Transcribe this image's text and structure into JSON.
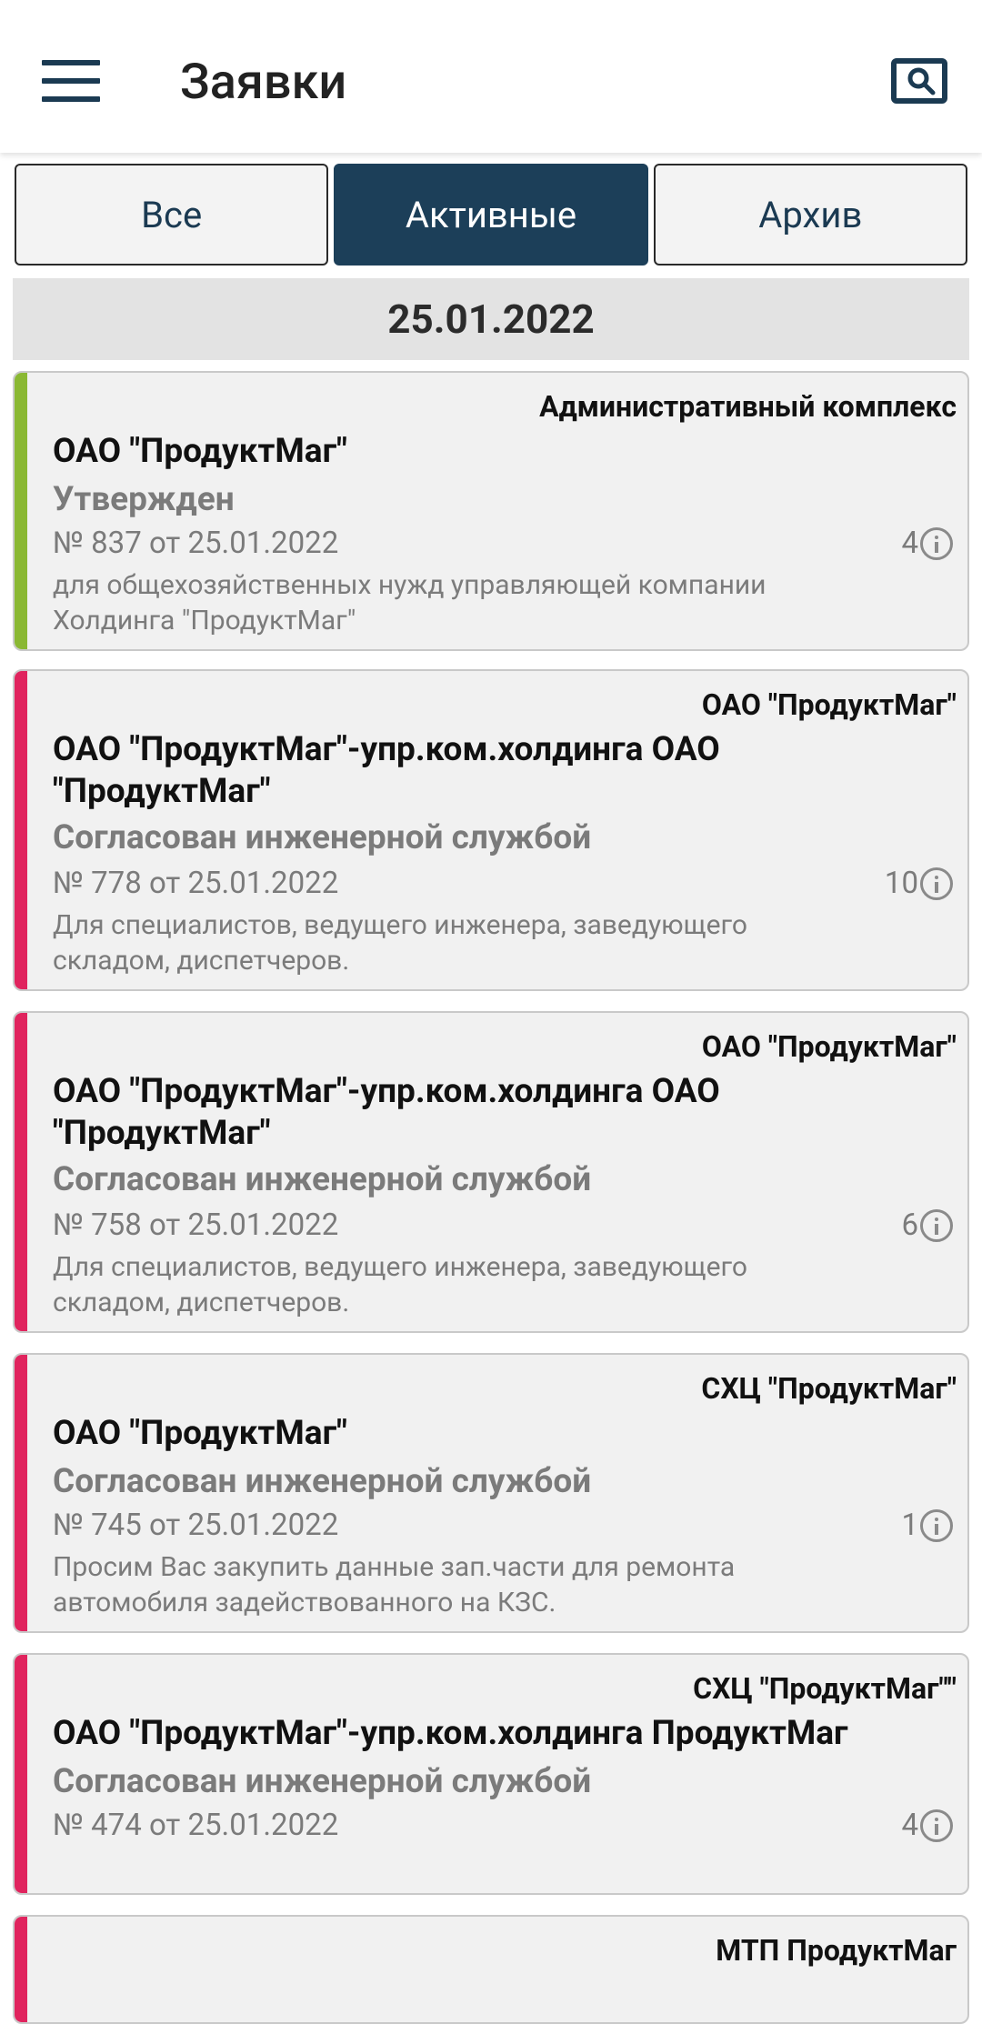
{
  "header": {
    "title": "Заявки",
    "menu_icon": "menu-icon",
    "search_icon": "search-icon"
  },
  "tabs": [
    {
      "label": "Все",
      "active": false
    },
    {
      "label": "Активные",
      "active": true
    },
    {
      "label": "Архив",
      "active": false
    }
  ],
  "date_group": "25.01.2022",
  "colors": {
    "primary": "#1c3f59",
    "approved": "#8ab833",
    "pending": "#e0245e"
  },
  "cards": [
    {
      "org": "Административный комплекс",
      "name": "ОАО \"ПродуктМаг\"",
      "status": "Утвержден",
      "number": "№ 837 от 25.01.2022",
      "description": "для общехозяйственных нужд управляющей компании Холдинга \"ПродуктМаг\"",
      "count": "4",
      "stripe_color": "#8ab833"
    },
    {
      "org": "ОАО \"ПродуктМаг\"",
      "name": "ОАО \"ПродуктМаг\"-упр.ком.холдинга ОАО \"ПродуктМаг\"",
      "status": "Согласован инженерной службой",
      "number": "№ 778 от 25.01.2022",
      "description": "Для специалистов, ведущего инженера, заведующего складом, диспетчеров.",
      "count": "10",
      "stripe_color": "#e0245e"
    },
    {
      "org": "ОАО \"ПродуктМаг\"",
      "name": "ОАО \"ПродуктМаг\"-упр.ком.холдинга ОАО \"ПродуктМаг\"",
      "status": "Согласован инженерной службой",
      "number": "№ 758 от 25.01.2022",
      "description": "Для специалистов, ведущего инженера, заведующего складом, диспетчеров.",
      "count": "6",
      "stripe_color": "#e0245e"
    },
    {
      "org": "СХЦ \"ПродуктМаг\"",
      "name": "ОАО \"ПродуктМаг\"",
      "status": "Согласован инженерной службой",
      "number": "№ 745 от 25.01.2022",
      "description": "Просим Вас закупить данные зап.части для ремонта автомобиля задействованного на КЗС.",
      "count": "1",
      "stripe_color": "#e0245e"
    },
    {
      "org": "СХЦ \"ПродуктМаг\"\"",
      "name": "ОАО \"ПродуктМаг\"-упр.ком.холдинга ПродуктМаг",
      "status": "Согласован инженерной службой",
      "number": "№ 474 от 25.01.2022",
      "description": "",
      "count": "4",
      "stripe_color": "#e0245e"
    },
    {
      "org": "МТП ПродуктМаг",
      "name": "",
      "status": "",
      "number": "",
      "description": "",
      "count": "",
      "stripe_color": "#e0245e"
    }
  ]
}
